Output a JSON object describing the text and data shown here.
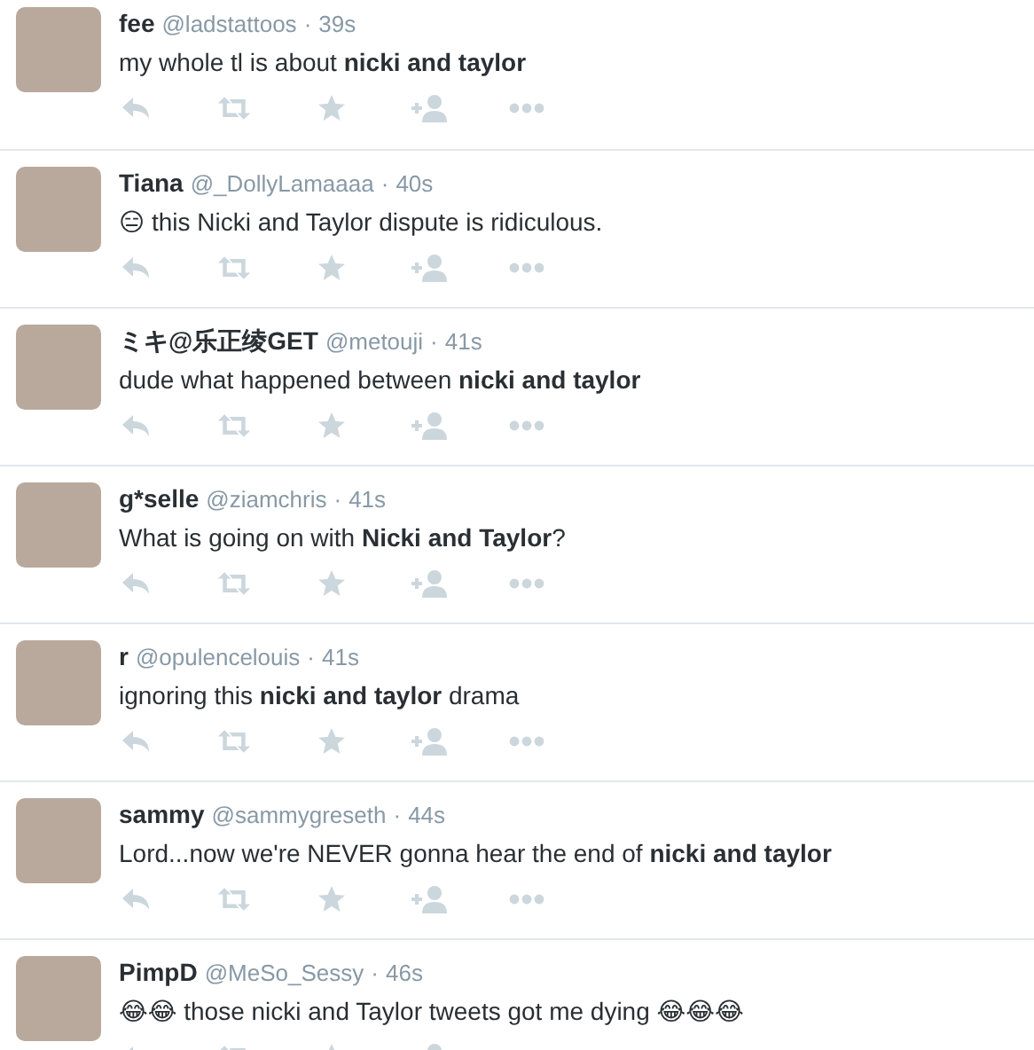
{
  "tweets": [
    {
      "name": "fee",
      "handle": "@ladstattoos",
      "separator": "·",
      "time": "39s",
      "text": "my whole tl is about **nicki and taylor**"
    },
    {
      "name": "Tiana",
      "handle": "@_DollyLamaaaa",
      "separator": "·",
      "time": "40s",
      "text": "😑 this Nicki and Taylor dispute is ridiculous."
    },
    {
      "name": "ミキ@乐正绫GET",
      "handle": "@metouji",
      "separator": "·",
      "time": "41s",
      "text": "dude what happened between **nicki and taylor**"
    },
    {
      "name": "g*selle",
      "handle": "@ziamchris",
      "separator": "·",
      "time": "41s",
      "text": "What is going on with **Nicki and Taylor**?"
    },
    {
      "name": "r",
      "handle": "@opulencelouis",
      "separator": "·",
      "time": "41s",
      "text": "ignoring this **nicki and taylor** drama"
    },
    {
      "name": "sammy",
      "handle": "@sammygreseth",
      "separator": "·",
      "time": "44s",
      "text": "Lord...now we're NEVER gonna hear the end of **nicki and taylor**"
    },
    {
      "name": "PimpD",
      "handle": "@MeSo_Sessy",
      "separator": "·",
      "time": "46s",
      "text": "😂😂 those nicki and Taylor tweets got me dying 😂😂😂"
    }
  ]
}
